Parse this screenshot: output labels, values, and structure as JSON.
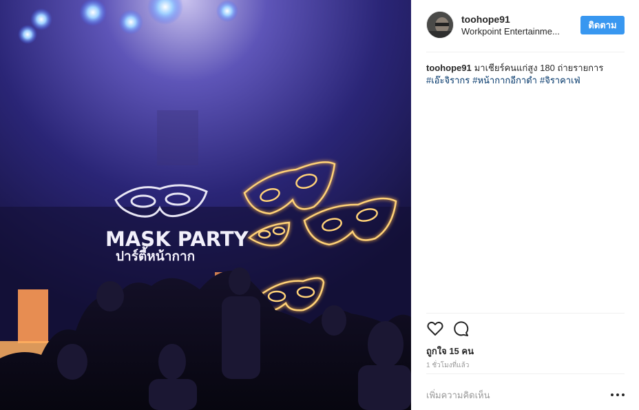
{
  "photo": {
    "sign_line1": "MASK PARTY",
    "sign_line2": "ปาร์ตี้หน้ากาก"
  },
  "post": {
    "username": "toohope91",
    "location": "Workpoint Entertainme...",
    "follow_label": "ติดตาม",
    "caption": {
      "username": "toohope91",
      "text": "มาเชียร์คนแก่สูง 180 ถ่ายรายการ",
      "tags": [
        "#เอ๊ะจิรากร",
        "#หน้ากากอีกาดำ",
        "#จิราคาเฟ่"
      ]
    },
    "likes": "ถูกใจ 15 คน",
    "time": "1 ชั่วโมงที่แล้ว",
    "comment_placeholder": "เพิ่มความคิดเห็น"
  },
  "icons": {
    "like": "heart-icon",
    "comment": "comment-icon",
    "more": "more-options-icon"
  },
  "colors": {
    "follow_button": "#3897f0",
    "hashtag": "#003569",
    "muted": "#999999",
    "text": "#262626"
  }
}
